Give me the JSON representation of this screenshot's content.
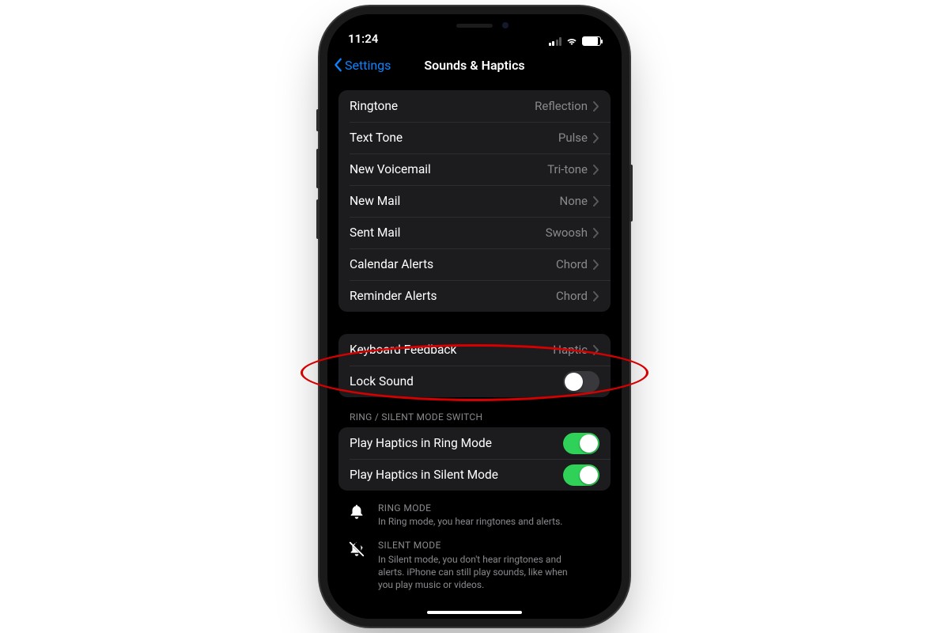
{
  "status": {
    "time": "11:24"
  },
  "nav": {
    "back_label": "Settings",
    "title": "Sounds & Haptics"
  },
  "sounds_group": {
    "items": [
      {
        "label": "Ringtone",
        "value": "Reflection"
      },
      {
        "label": "Text Tone",
        "value": "Pulse"
      },
      {
        "label": "New Voicemail",
        "value": "Tri-tone"
      },
      {
        "label": "New Mail",
        "value": "None"
      },
      {
        "label": "Sent Mail",
        "value": "Swoosh"
      },
      {
        "label": "Calendar Alerts",
        "value": "Chord"
      },
      {
        "label": "Reminder Alerts",
        "value": "Chord"
      }
    ]
  },
  "keyboard_group": {
    "feedback_label": "Keyboard Feedback",
    "feedback_value": "Haptic",
    "lock_sound_label": "Lock Sound",
    "lock_sound_on": false
  },
  "ring_silent_header": "RING / SILENT MODE SWITCH",
  "haptics_group": {
    "ring_label": "Play Haptics in Ring Mode",
    "ring_on": true,
    "silent_label": "Play Haptics in Silent Mode",
    "silent_on": true
  },
  "info": {
    "ring_title": "RING MODE",
    "ring_desc": "In Ring mode, you hear ringtones and alerts.",
    "silent_title": "SILENT MODE",
    "silent_desc": "In Silent mode, you don't hear ringtones and alerts. iPhone can still play sounds, like when you play music or videos."
  },
  "colors": {
    "accent_blue": "#0a84ff",
    "toggle_green": "#30d158",
    "annotation_red": "#d60000"
  }
}
